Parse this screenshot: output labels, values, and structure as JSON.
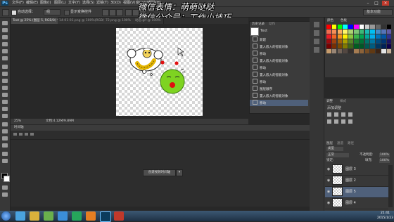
{
  "app": {
    "logo": "Ps"
  },
  "menubar": {
    "items": [
      "文件(F)",
      "编辑(E)",
      "图像(I)",
      "图层(L)",
      "文字(Y)",
      "选择(S)",
      "滤镜(T)",
      "3D(D)",
      "视图(V)",
      "窗口(W)",
      "帮助(H)"
    ],
    "window_buttons": [
      "–",
      "□",
      "×"
    ]
  },
  "options": {
    "auto_select_label": "自动选择：",
    "auto_select_value": "组",
    "show_transform_label": "显示变换控件",
    "workspace_label": "基本功能"
  },
  "overlay": {
    "line1": "微信表情：萌萌哒哒",
    "line2": "微信公众号：工作小技巧"
  },
  "tabs": [
    {
      "label": "Text @ 25% (图层 5, RGB/8) *",
      "active": true
    },
    {
      "label": "14-01-01.png @ 100%(RGB/8)",
      "active": false
    },
    {
      "label": "72.png @ 100%",
      "active": false
    },
    {
      "label": "动态.gif @ 100%",
      "active": false
    }
  ],
  "status": {
    "zoom": "25%",
    "doc": "文档:4.12M/9.89M"
  },
  "timeline": {
    "title": "时间轴",
    "create_button": "创建视频时间轴",
    "dropdown": "▾"
  },
  "history": {
    "tabs": [
      "历史记录",
      "动作"
    ],
    "snapshot": "Text",
    "items": [
      "新建",
      "置入嵌入的智能对象",
      "移动",
      "置入嵌入的智能对象",
      "移动",
      "置入嵌入的智能对象",
      "移动",
      "图层顺序",
      "置入嵌入的智能对象",
      "移动"
    ],
    "selected_index": 9
  },
  "swatches": {
    "tabs": [
      "颜色",
      "色板"
    ],
    "colors": [
      "#ff0000",
      "#ffff00",
      "#00ff00",
      "#00ffff",
      "#0000ff",
      "#ff00ff",
      "#ffffff",
      "#cccccc",
      "#999999",
      "#666666",
      "#333333",
      "#000000",
      "#f26c4f",
      "#f68e56",
      "#fbaf5d",
      "#fff568",
      "#acd372",
      "#7cc576",
      "#3bb878",
      "#1abbb4",
      "#00bff3",
      "#438ccb",
      "#5574b9",
      "#605ca8",
      "#ed1c24",
      "#f26522",
      "#f7941d",
      "#fff200",
      "#8dc63f",
      "#39b54a",
      "#00a651",
      "#00a99d",
      "#00aeef",
      "#0072bc",
      "#0054a6",
      "#2e3192",
      "#9e0b0f",
      "#a0410d",
      "#a36209",
      "#aba000",
      "#598527",
      "#1a7b30",
      "#007236",
      "#00746b",
      "#0076a3",
      "#004b80",
      "#003471",
      "#1b1464",
      "#790000",
      "#7b2e00",
      "#7d4900",
      "#827b00",
      "#406618",
      "#005e20",
      "#005826",
      "#005952",
      "#005b7f",
      "#003663",
      "#002157",
      "#0d004c",
      "#c69c6d",
      "#998675",
      "#736357",
      "#534741",
      "#37302d",
      "#a67c52",
      "#8c6239",
      "#754c24",
      "#603913",
      "#3c2415",
      "#e6e6e6",
      "#c7b299"
    ]
  },
  "adjustments": {
    "tabs": [
      "调整",
      "样式"
    ],
    "title": "添加调整"
  },
  "layers": {
    "tabs": [
      "图层",
      "通道",
      "路径"
    ],
    "kind_label": "类型",
    "blend_mode": "正常",
    "opacity_label": "不透明度:",
    "opacity_value": "100%",
    "lock_label": "锁定:",
    "fill_label": "填充:",
    "fill_value": "100%",
    "items": [
      {
        "name": "图层 3",
        "selected": false
      },
      {
        "name": "图层 2",
        "selected": false
      },
      {
        "name": "图层 5",
        "selected": true
      },
      {
        "name": "图层 4",
        "selected": false
      }
    ]
  },
  "taskbar": {
    "time": "21:41",
    "date": "2015/1/23"
  }
}
